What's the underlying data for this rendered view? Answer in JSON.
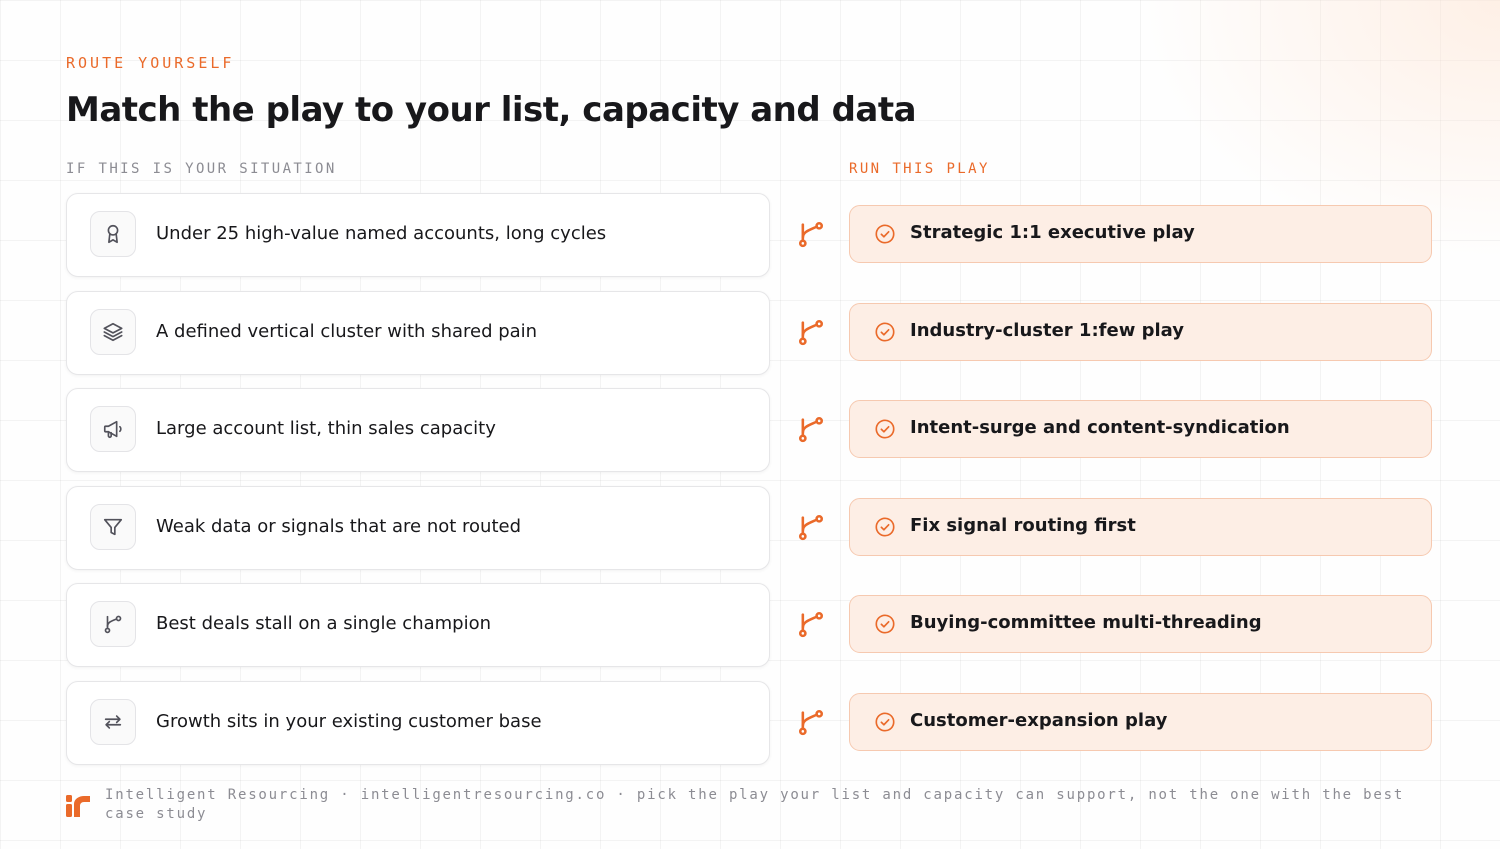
{
  "eyebrow": "ROUTE YOURSELF",
  "title": "Match the play to your list, capacity and data",
  "columns": {
    "left_heading": "IF THIS IS YOUR SITUATION",
    "right_heading": "RUN THIS PLAY"
  },
  "rows": [
    {
      "icon": "award-icon",
      "situation": "Under 25 high-value named accounts, long cycles",
      "play": "Strategic 1:1 executive play"
    },
    {
      "icon": "layers-icon",
      "situation": "A defined vertical cluster with shared pain",
      "play": "Industry-cluster 1:few play"
    },
    {
      "icon": "megaphone-icon",
      "situation": "Large account list, thin sales capacity",
      "play": "Intent-surge and content-syndication"
    },
    {
      "icon": "filter-icon",
      "situation": "Weak data or signals that are not routed",
      "play": "Fix signal routing first"
    },
    {
      "icon": "branch-icon",
      "situation": "Best deals stall on a single champion",
      "play": "Buying-committee multi-threading"
    },
    {
      "icon": "repeat-icon",
      "situation": "Growth sits in your existing customer base",
      "play": "Customer-expansion play"
    }
  ],
  "footer": {
    "text": "Intelligent Resourcing · intelligentresourcing.co · pick the play your list and capacity can support, not the one with the best case study"
  },
  "colors": {
    "accent": "#ea6a2a",
    "play_background": "#fdeee5",
    "play_border": "#f6c9b0",
    "muted_text": "#8c8c93"
  }
}
